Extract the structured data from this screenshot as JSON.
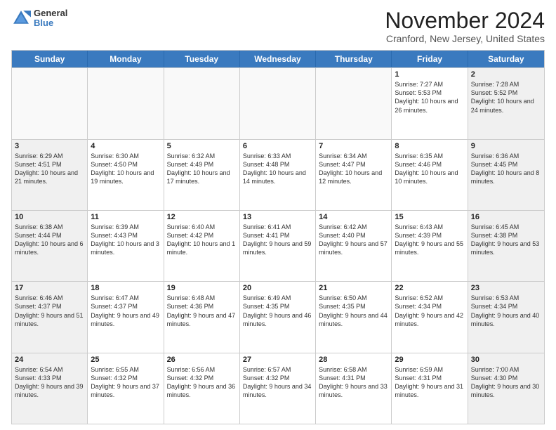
{
  "header": {
    "logo_general": "General",
    "logo_blue": "Blue",
    "title": "November 2024",
    "subtitle": "Cranford, New Jersey, United States"
  },
  "weekdays": [
    "Sunday",
    "Monday",
    "Tuesday",
    "Wednesday",
    "Thursday",
    "Friday",
    "Saturday"
  ],
  "rows": [
    [
      {
        "day": "",
        "info": "",
        "empty": true
      },
      {
        "day": "",
        "info": "",
        "empty": true
      },
      {
        "day": "",
        "info": "",
        "empty": true
      },
      {
        "day": "",
        "info": "",
        "empty": true
      },
      {
        "day": "",
        "info": "",
        "empty": true
      },
      {
        "day": "1",
        "info": "Sunrise: 7:27 AM\nSunset: 5:53 PM\nDaylight: 10 hours\nand 26 minutes."
      },
      {
        "day": "2",
        "info": "Sunrise: 7:28 AM\nSunset: 5:52 PM\nDaylight: 10 hours\nand 24 minutes.",
        "shaded": true
      }
    ],
    [
      {
        "day": "3",
        "info": "Sunrise: 6:29 AM\nSunset: 4:51 PM\nDaylight: 10 hours\nand 21 minutes.",
        "shaded": true
      },
      {
        "day": "4",
        "info": "Sunrise: 6:30 AM\nSunset: 4:50 PM\nDaylight: 10 hours\nand 19 minutes."
      },
      {
        "day": "5",
        "info": "Sunrise: 6:32 AM\nSunset: 4:49 PM\nDaylight: 10 hours\nand 17 minutes."
      },
      {
        "day": "6",
        "info": "Sunrise: 6:33 AM\nSunset: 4:48 PM\nDaylight: 10 hours\nand 14 minutes."
      },
      {
        "day": "7",
        "info": "Sunrise: 6:34 AM\nSunset: 4:47 PM\nDaylight: 10 hours\nand 12 minutes."
      },
      {
        "day": "8",
        "info": "Sunrise: 6:35 AM\nSunset: 4:46 PM\nDaylight: 10 hours\nand 10 minutes."
      },
      {
        "day": "9",
        "info": "Sunrise: 6:36 AM\nSunset: 4:45 PM\nDaylight: 10 hours\nand 8 minutes.",
        "shaded": true
      }
    ],
    [
      {
        "day": "10",
        "info": "Sunrise: 6:38 AM\nSunset: 4:44 PM\nDaylight: 10 hours\nand 6 minutes.",
        "shaded": true
      },
      {
        "day": "11",
        "info": "Sunrise: 6:39 AM\nSunset: 4:43 PM\nDaylight: 10 hours\nand 3 minutes."
      },
      {
        "day": "12",
        "info": "Sunrise: 6:40 AM\nSunset: 4:42 PM\nDaylight: 10 hours\nand 1 minute."
      },
      {
        "day": "13",
        "info": "Sunrise: 6:41 AM\nSunset: 4:41 PM\nDaylight: 9 hours\nand 59 minutes."
      },
      {
        "day": "14",
        "info": "Sunrise: 6:42 AM\nSunset: 4:40 PM\nDaylight: 9 hours\nand 57 minutes."
      },
      {
        "day": "15",
        "info": "Sunrise: 6:43 AM\nSunset: 4:39 PM\nDaylight: 9 hours\nand 55 minutes."
      },
      {
        "day": "16",
        "info": "Sunrise: 6:45 AM\nSunset: 4:38 PM\nDaylight: 9 hours\nand 53 minutes.",
        "shaded": true
      }
    ],
    [
      {
        "day": "17",
        "info": "Sunrise: 6:46 AM\nSunset: 4:37 PM\nDaylight: 9 hours\nand 51 minutes.",
        "shaded": true
      },
      {
        "day": "18",
        "info": "Sunrise: 6:47 AM\nSunset: 4:37 PM\nDaylight: 9 hours\nand 49 minutes."
      },
      {
        "day": "19",
        "info": "Sunrise: 6:48 AM\nSunset: 4:36 PM\nDaylight: 9 hours\nand 47 minutes."
      },
      {
        "day": "20",
        "info": "Sunrise: 6:49 AM\nSunset: 4:35 PM\nDaylight: 9 hours\nand 46 minutes."
      },
      {
        "day": "21",
        "info": "Sunrise: 6:50 AM\nSunset: 4:35 PM\nDaylight: 9 hours\nand 44 minutes."
      },
      {
        "day": "22",
        "info": "Sunrise: 6:52 AM\nSunset: 4:34 PM\nDaylight: 9 hours\nand 42 minutes."
      },
      {
        "day": "23",
        "info": "Sunrise: 6:53 AM\nSunset: 4:34 PM\nDaylight: 9 hours\nand 40 minutes.",
        "shaded": true
      }
    ],
    [
      {
        "day": "24",
        "info": "Sunrise: 6:54 AM\nSunset: 4:33 PM\nDaylight: 9 hours\nand 39 minutes.",
        "shaded": true
      },
      {
        "day": "25",
        "info": "Sunrise: 6:55 AM\nSunset: 4:32 PM\nDaylight: 9 hours\nand 37 minutes."
      },
      {
        "day": "26",
        "info": "Sunrise: 6:56 AM\nSunset: 4:32 PM\nDaylight: 9 hours\nand 36 minutes."
      },
      {
        "day": "27",
        "info": "Sunrise: 6:57 AM\nSunset: 4:32 PM\nDaylight: 9 hours\nand 34 minutes."
      },
      {
        "day": "28",
        "info": "Sunrise: 6:58 AM\nSunset: 4:31 PM\nDaylight: 9 hours\nand 33 minutes."
      },
      {
        "day": "29",
        "info": "Sunrise: 6:59 AM\nSunset: 4:31 PM\nDaylight: 9 hours\nand 31 minutes."
      },
      {
        "day": "30",
        "info": "Sunrise: 7:00 AM\nSunset: 4:30 PM\nDaylight: 9 hours\nand 30 minutes.",
        "shaded": true
      }
    ]
  ]
}
